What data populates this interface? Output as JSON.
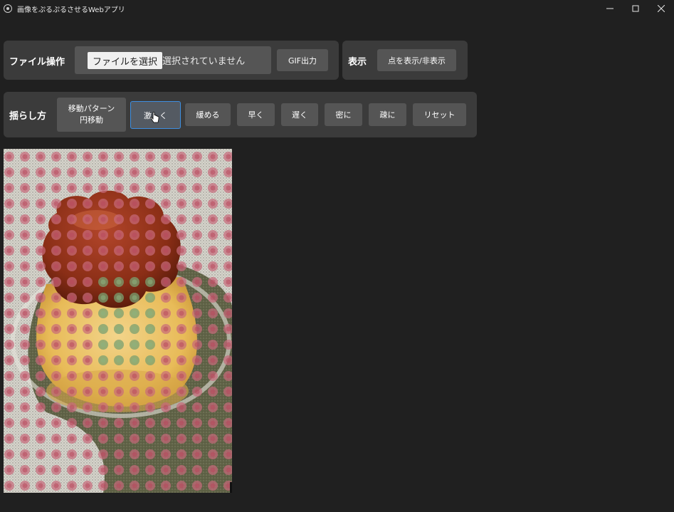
{
  "window": {
    "title": "画像をぷるぷるさせるWebアプリ",
    "controls": [
      "minimize-icon",
      "maximize-icon",
      "close-icon"
    ]
  },
  "file_panel": {
    "label": "ファイル操作",
    "choose_button": "ファイルを選択",
    "status": "選択されていません",
    "gif_button": "GIF出力"
  },
  "display_panel": {
    "label": "表示",
    "toggle_button": "点を表示/非表示"
  },
  "shake_panel": {
    "label": "揺らし方",
    "pattern_button_line1": "移動パターン",
    "pattern_button_line2": "円移動",
    "buttons": [
      "激しく",
      "緩める",
      "早く",
      "遅く",
      "密に",
      "疎に",
      "リセット"
    ]
  },
  "colors": {
    "background": "#202020",
    "panel": "#3b3b3b",
    "button": "#555555",
    "active_border": "#3d8ee0",
    "dot": "#c86a7a"
  },
  "image": {
    "description_icon": "pudding-image-with-dot-grid"
  }
}
